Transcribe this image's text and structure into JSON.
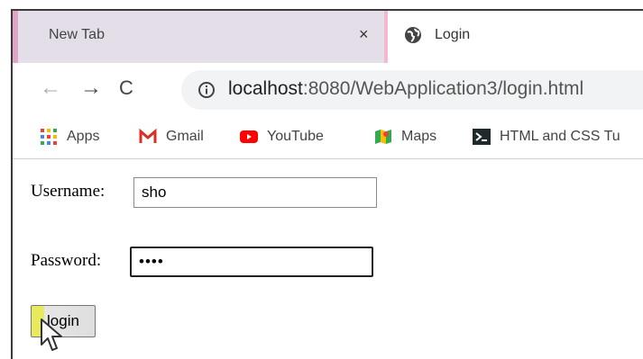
{
  "tabs": [
    {
      "title": "New Tab",
      "close_glyph": "×",
      "active": false
    },
    {
      "title": "Login",
      "icon": "globe-icon",
      "active": true
    }
  ],
  "toolbar": {
    "back_glyph": "←",
    "forward_glyph": "→",
    "reload_glyph": "C",
    "url_host": "localhost",
    "url_rest": ":8080/WebApplication3/login.html"
  },
  "bookmarks": [
    {
      "label": "Apps",
      "icon": "apps-grid-icon"
    },
    {
      "label": "Gmail",
      "icon": "gmail-icon"
    },
    {
      "label": "YouTube",
      "icon": "youtube-icon"
    },
    {
      "label": "Maps",
      "icon": "maps-icon"
    },
    {
      "label": "HTML and CSS Tu",
      "icon": "terminal-icon"
    }
  ],
  "form": {
    "username_label": "Username:",
    "username_value": "sho",
    "password_label": "Password:",
    "password_value": "••••",
    "login_button": "login"
  },
  "colors": {
    "tab_strip": "#dfe1e5",
    "inactive_tab": "#e3dee8",
    "tab_accent": "#e0a6c8",
    "omnibox": "#f1f3f4",
    "button_highlight": "#e8e95c"
  }
}
